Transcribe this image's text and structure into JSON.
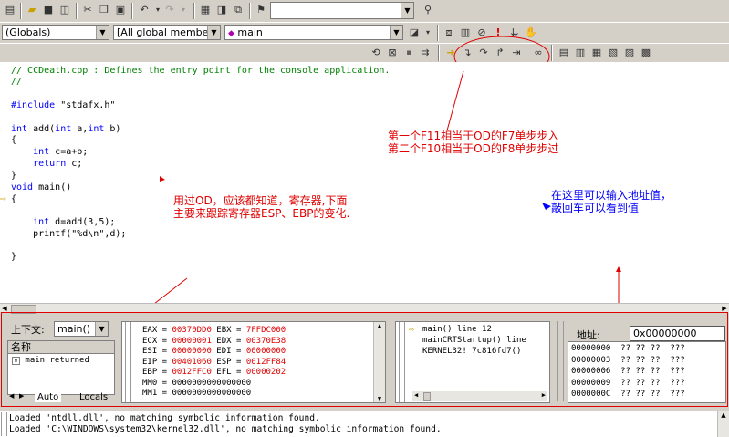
{
  "toolbar1": {
    "find_value": ""
  },
  "wizardbar": {
    "class_combo": "(Globals)",
    "members_combo": "[All global members",
    "function_combo": "main"
  },
  "editor": {
    "lines": [
      "// CCDeath.cpp : Defines the entry point for the console application.",
      "//",
      "",
      "#include \"stdafx.h\"",
      "",
      "int add(int a,int b)",
      "{",
      "    int c=a+b;",
      "    return c;",
      "}",
      "void main()",
      "{",
      "",
      "    int d=add(3,5);",
      "    printf(\"%d\\n\",d);",
      "",
      "",
      "}"
    ]
  },
  "annotations": {
    "step_note_1": "第一个F11相当于OD的F7单步步入",
    "step_note_2": "第二个F10相当于OD的F8单步步过",
    "register_note": "用过OD，应该都知道，寄存器,下面主要来跟踪寄存器ESP、EBP的变化.",
    "address_note": "在这里可以输入地址值，敲回车可以看到值"
  },
  "variables": {
    "context_label": "上下文:",
    "context_value": "main()",
    "name_header": "名称",
    "row": "main returned",
    "tab_auto": "Auto",
    "tab_locals": "Locals"
  },
  "registers": {
    "lines": [
      [
        "EAX = ",
        "00370DD0",
        " EBX = ",
        "7FFDC000"
      ],
      [
        "ECX = ",
        "00000001",
        " EDX = ",
        "00370E38"
      ],
      [
        "ESI = ",
        "00000000",
        " EDI = ",
        "00000000"
      ],
      [
        "EIP = ",
        "00401060",
        " ESP = ",
        "0012FF84"
      ],
      [
        "EBP = ",
        "0012FFC0",
        " EFL = ",
        "00000202"
      ],
      [
        "MM0 = ",
        "0000000000000000",
        "",
        ""
      ],
      [
        "MM1 = ",
        "0000000000000000",
        "",
        ""
      ]
    ]
  },
  "callstack": {
    "items": [
      "main() line 12",
      "mainCRTStartup() line",
      "KERNEL32! 7c816fd7()"
    ]
  },
  "memory": {
    "address_label": "地址:",
    "address_value": "0x00000000",
    "rows": [
      "00000000  ?? ?? ??  ???",
      "00000003  ?? ?? ??  ???",
      "00000006  ?? ?? ??  ???",
      "00000009  ?? ?? ??  ???",
      "0000000C  ?? ?? ??  ???"
    ]
  },
  "output": {
    "lines": [
      "Loaded 'ntdll.dll', no matching symbolic information found.",
      "Loaded 'C:\\WINDOWS\\system32\\kernel32.dll', no matching symbolic information found."
    ]
  }
}
